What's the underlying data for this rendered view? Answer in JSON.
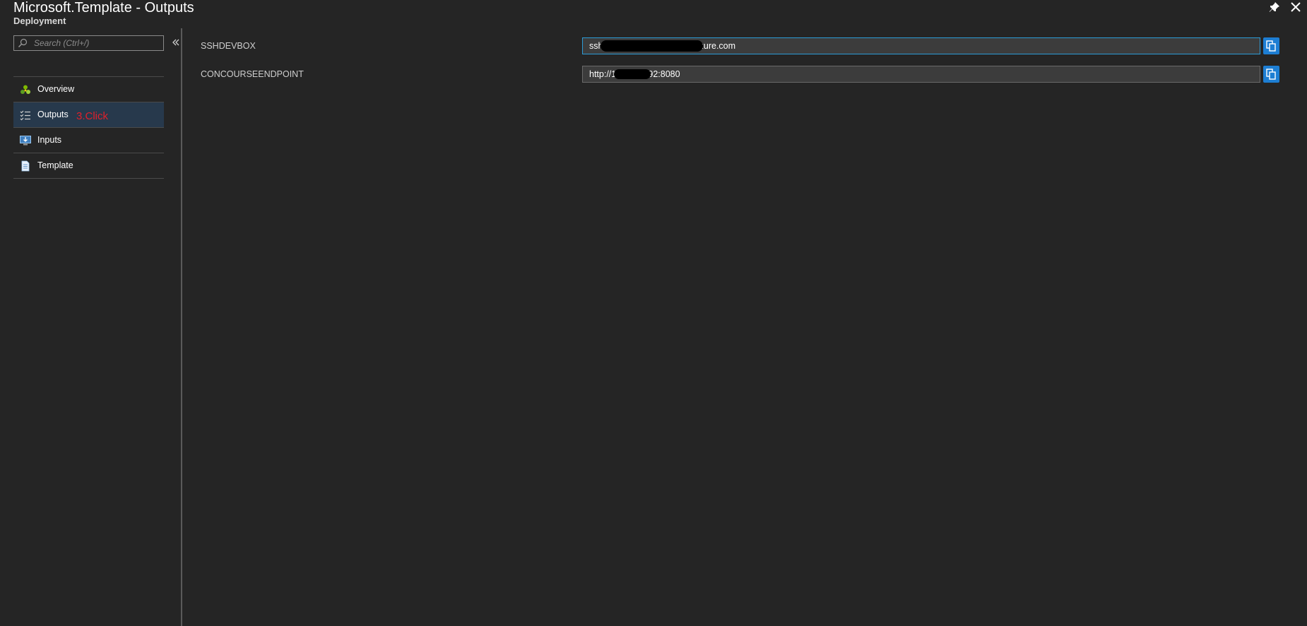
{
  "header": {
    "title": "Microsoft.Template - Outputs",
    "subtitle": "Deployment"
  },
  "search": {
    "placeholder": "Search (Ctrl+/)",
    "value": ""
  },
  "sidebar": {
    "items": [
      {
        "label": "Overview",
        "icon": "overview-icon",
        "active": false
      },
      {
        "label": "Outputs",
        "icon": "outputs-icon",
        "active": true
      },
      {
        "label": "Inputs",
        "icon": "inputs-icon",
        "active": false
      },
      {
        "label": "Template",
        "icon": "template-icon",
        "active": false
      }
    ],
    "annotation": "3.Click"
  },
  "outputs": [
    {
      "name": "SSHDEVBOX",
      "value": "ssh t          astus.cloudapp.azure.com"
    },
    {
      "name": "CONCOURSEENDPOINT",
      "value": "http://1            .92:8080"
    }
  ],
  "colors": {
    "background": "#252525",
    "accent": "#1d7ed3",
    "active_item": "#27394c",
    "annotation": "#e0202a",
    "focus_border": "#2b9bd6"
  }
}
